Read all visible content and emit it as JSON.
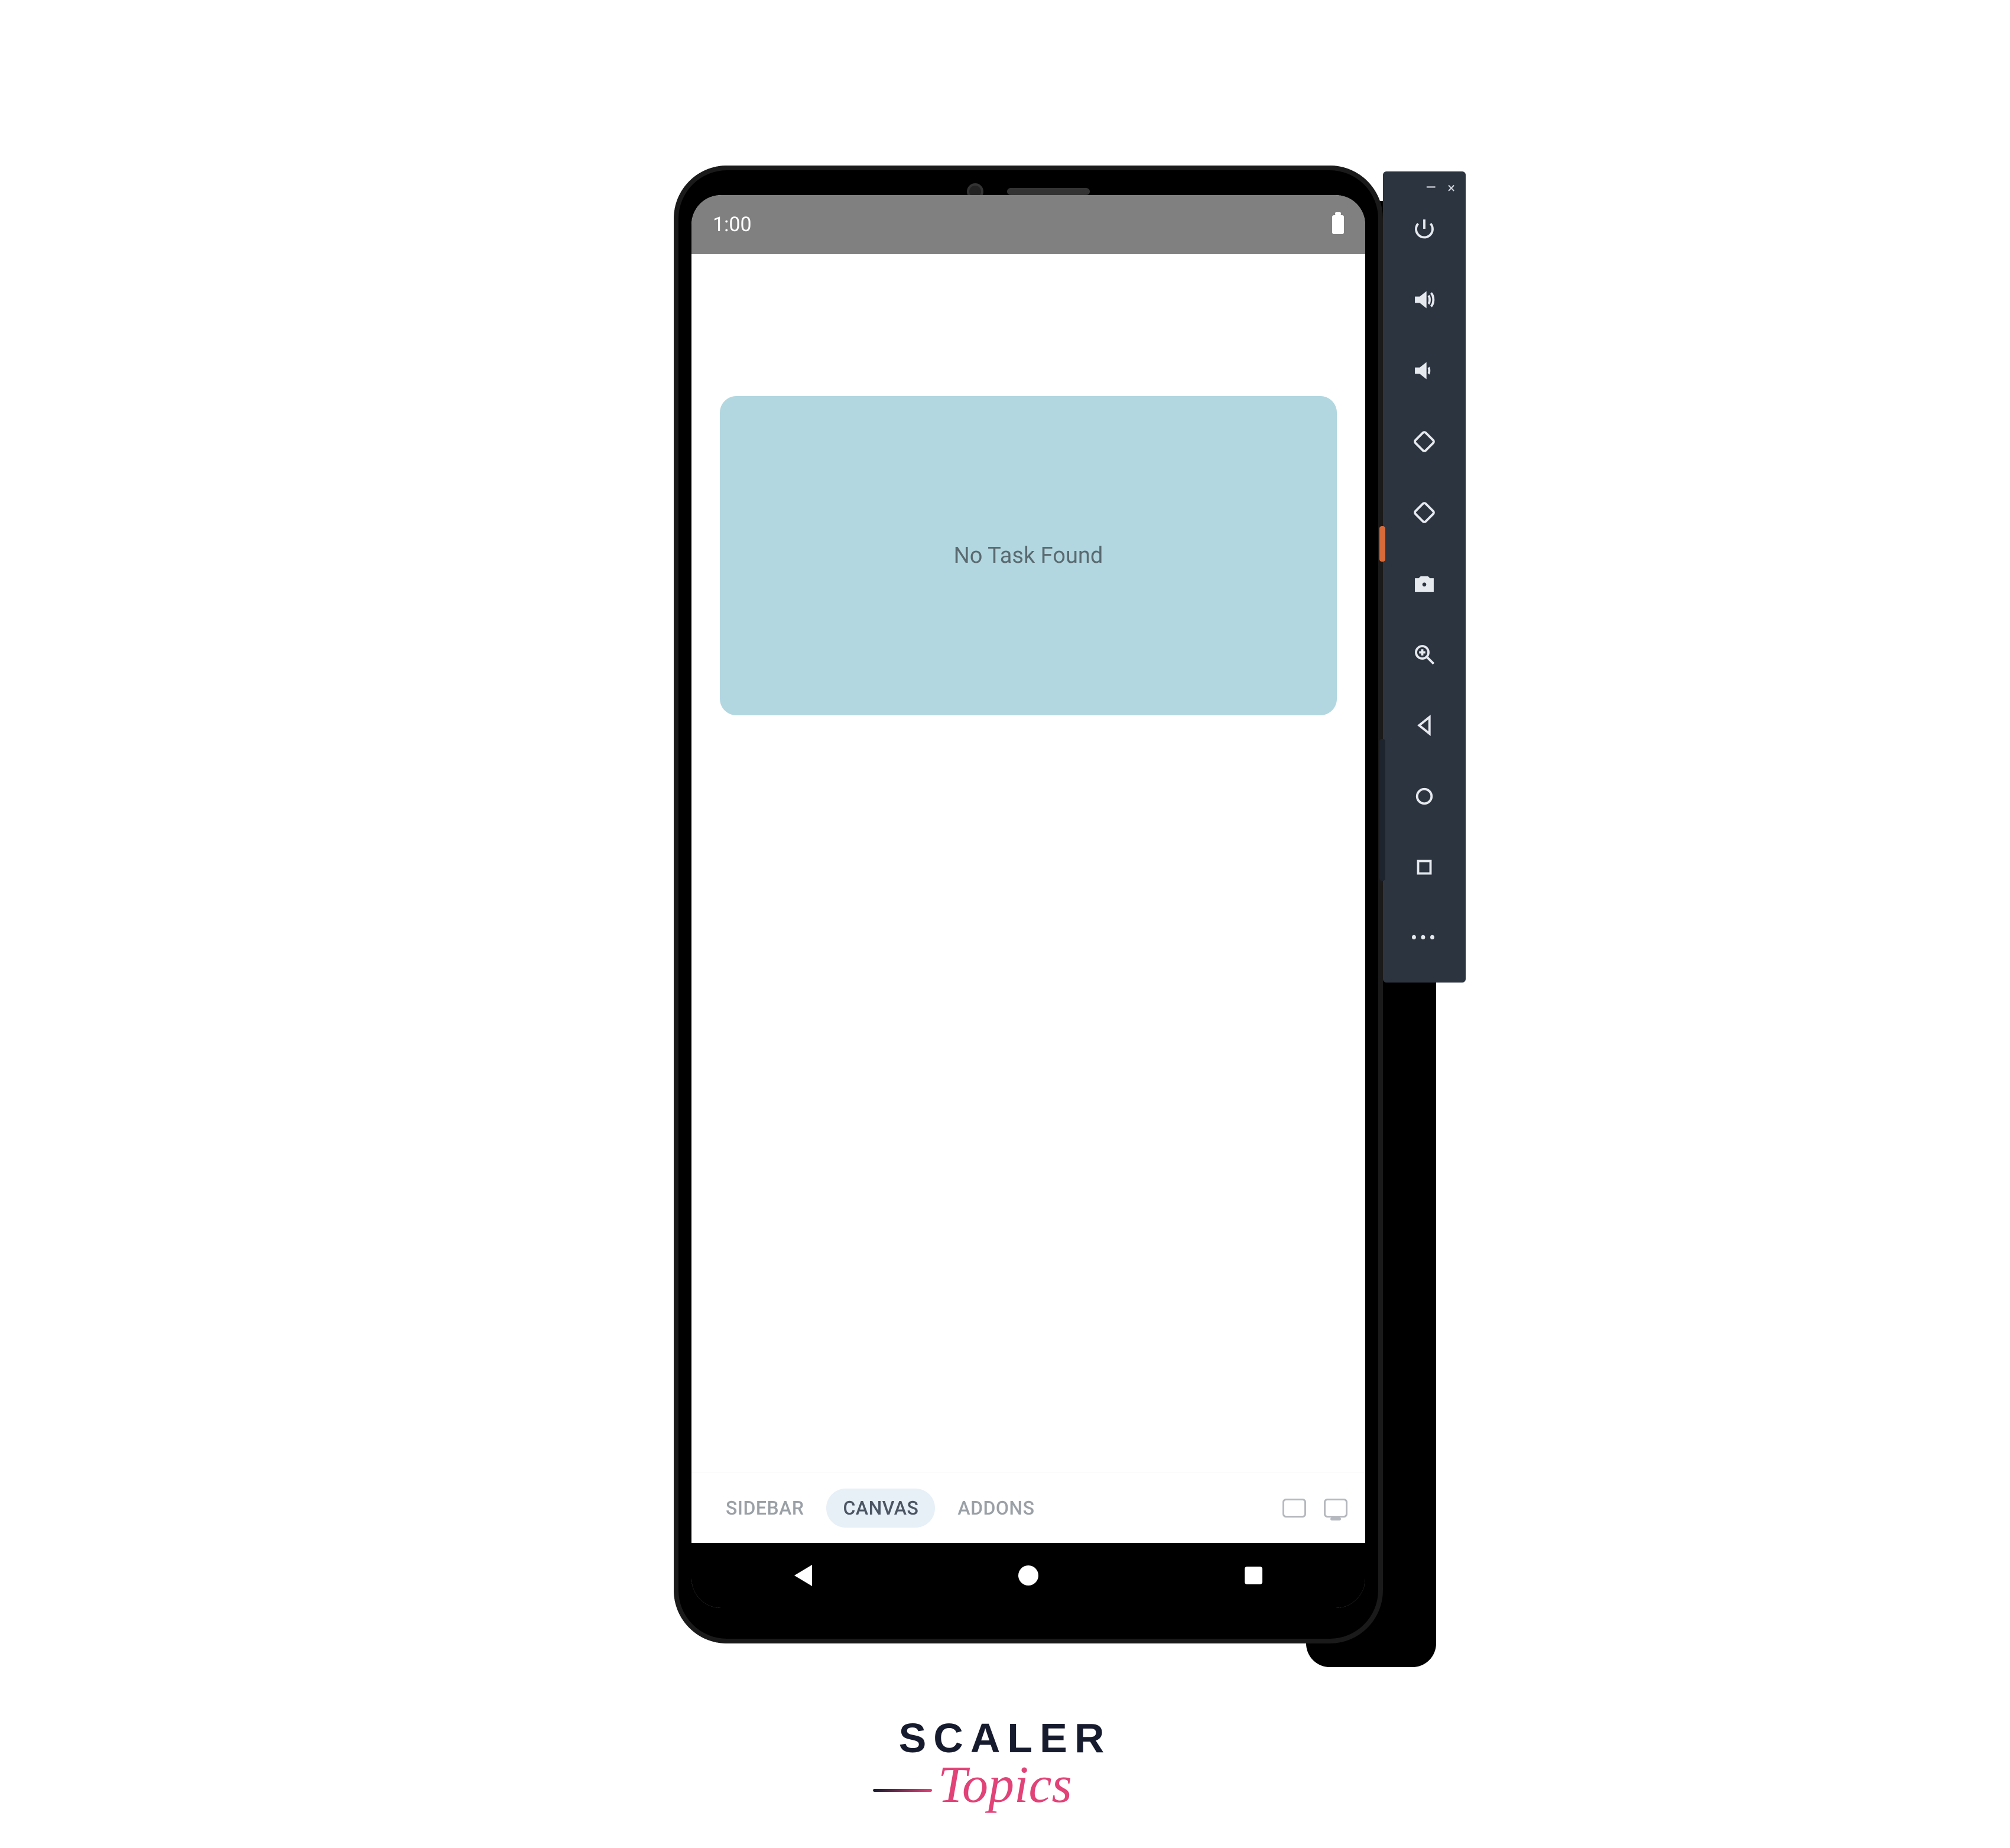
{
  "status_bar": {
    "time": "1:00"
  },
  "app": {
    "card_text": "No Task Found",
    "tabs": {
      "sidebar": "SIDEBAR",
      "canvas": "CANVAS",
      "addons": "ADDONS",
      "active": "canvas"
    }
  },
  "side_panel": {
    "window_controls": {
      "minimize": "–",
      "close": "×"
    },
    "buttons": [
      "power",
      "volume-up",
      "volume-down",
      "rotate-left",
      "rotate-right",
      "camera",
      "zoom",
      "back",
      "home",
      "overview",
      "more"
    ]
  },
  "branding": {
    "main": "SCALER",
    "sub": "Topics"
  }
}
